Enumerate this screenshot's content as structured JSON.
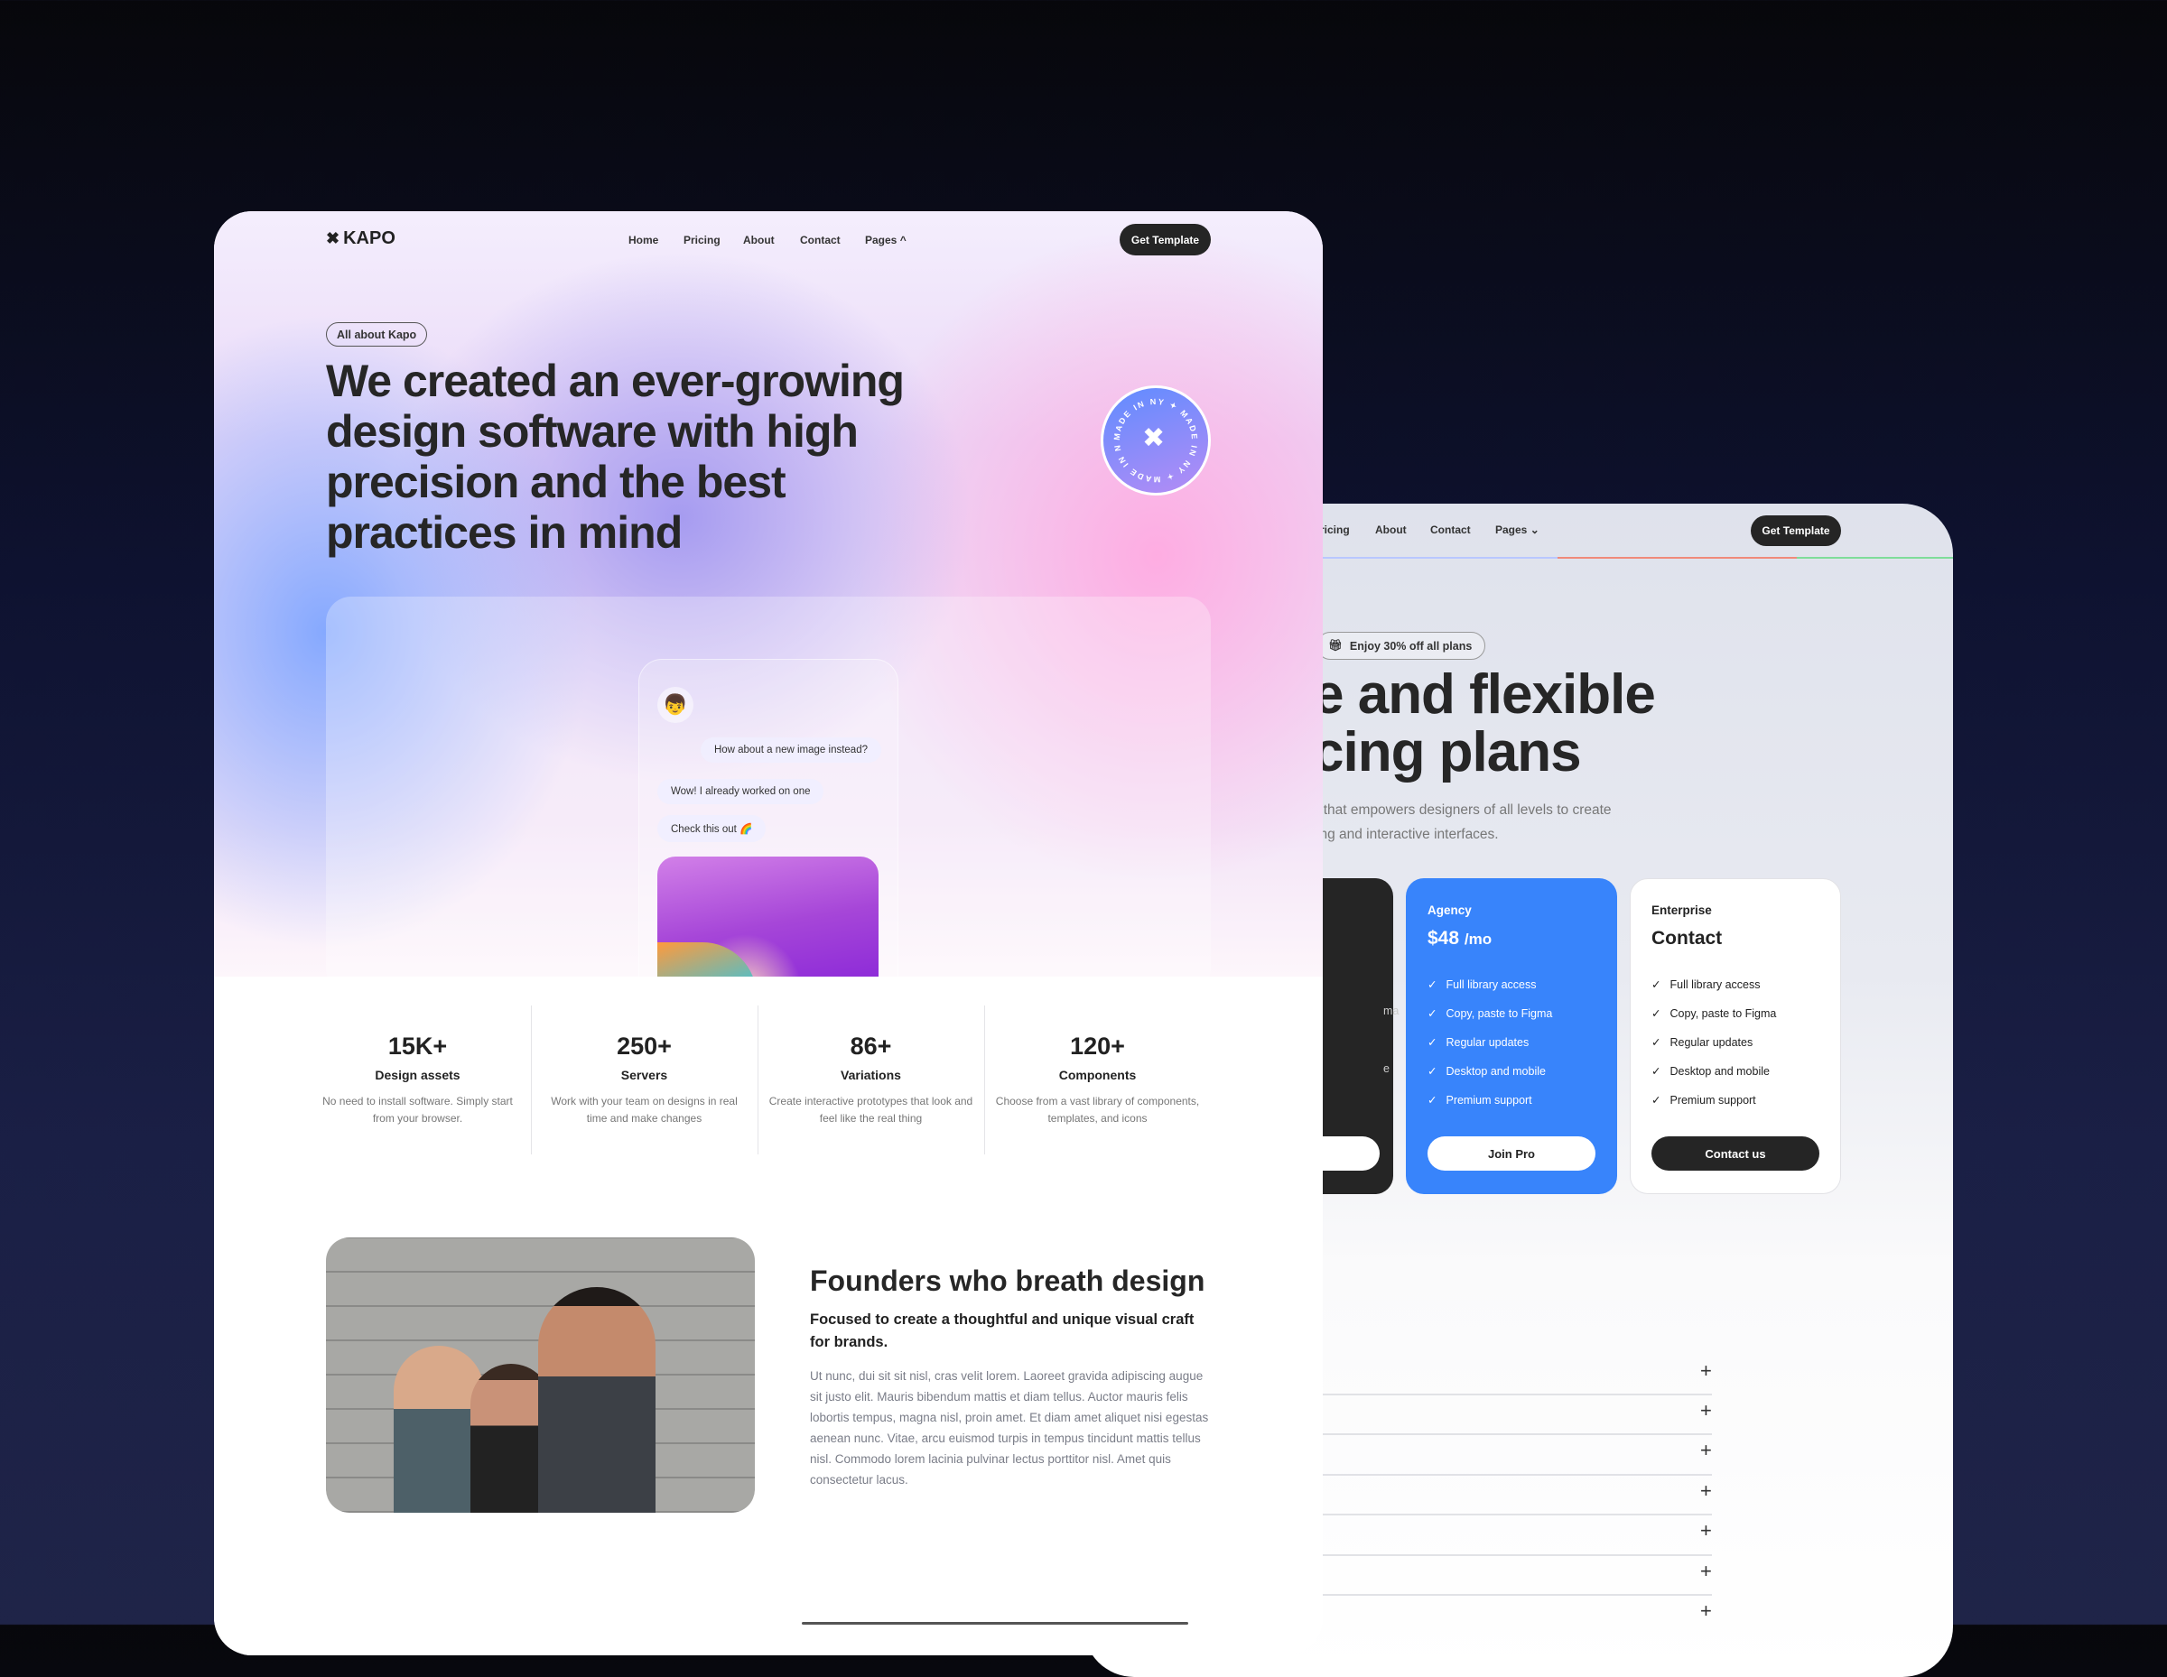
{
  "back_page": {
    "nav": {
      "items": [
        "ricing",
        "About",
        "Contact",
        "Pages"
      ],
      "cta": "Get Template"
    },
    "progress_colors": [
      "#b9c7ff",
      "#f08a7a",
      "#7fdc9a"
    ],
    "badge": {
      "icon": "gift-icon",
      "label": "Enjoy 30% off all plans"
    },
    "heading_lines": [
      "e and flexible",
      "cing plans"
    ],
    "subtitle_lines": [
      "l that empowers designers of all levels to create",
      "ing and interactive interfaces."
    ],
    "plans": [
      {
        "partial_features": [
          "ma",
          "e"
        ]
      },
      {
        "name": "Agency",
        "price": "$48",
        "period": "/mo",
        "features": [
          "Full library access",
          "Copy, paste to Figma",
          "Regular updates",
          "Desktop and mobile",
          "Premium support"
        ],
        "button": "Join Pro",
        "color": "#3884fb"
      },
      {
        "name": "Enterprise",
        "price": "Contact",
        "features": [
          "Full library access",
          "Copy, paste to Figma",
          "Regular updates",
          "Desktop and mobile",
          "Premium support"
        ],
        "button": "Contact us"
      }
    ],
    "faq_icon": "plus-icon"
  },
  "front_page": {
    "logo": "KAPO",
    "nav": {
      "items": [
        "Home",
        "Pricing",
        "About",
        "Contact",
        "Pages"
      ],
      "cta": "Get Template"
    },
    "badge": "All about Kapo",
    "heading_lines": [
      "We created an ever-growing",
      "design software with high",
      "precision and the best",
      "practices in mind"
    ],
    "stamp": "MADE IN NY ✦ MADE IN NY ✦ MADE IN NY ✦",
    "chat": {
      "outgoing": "How about a new image instead?",
      "incoming": [
        "Wow! I already worked on one",
        "Check this out 🌈"
      ]
    },
    "stats": [
      {
        "value": "15K+",
        "label": "Design assets",
        "desc": "No need to install software. Simply start from your browser."
      },
      {
        "value": "250+",
        "label": "Servers",
        "desc": "Work with your team on designs in real time and make changes"
      },
      {
        "value": "86+",
        "label": "Variations",
        "desc": "Create interactive prototypes that look and feel like the real thing"
      },
      {
        "value": "120+",
        "label": "Components",
        "desc": "Choose from a vast library of components, templates, and icons"
      }
    ],
    "founders": {
      "title": "Founders who breath design",
      "subtitle": "Focused to create a thoughtful and unique visual craft for brands.",
      "body": "Ut nunc, dui sit sit nisl, cras velit lorem. Laoreet gravida adipiscing augue sit justo elit. Mauris bibendum mattis et diam tellus. Auctor mauris felis lobortis tempus, magna nisl, proin amet. Et diam amet aliquet nisi egestas aenean nunc. Vitae, arcu euismod turpis in tempus tincidunt mattis tellus nisl. Commodo lorem lacinia pulvinar lectus porttitor nisl. Amet quis consectetur lacus."
    }
  }
}
